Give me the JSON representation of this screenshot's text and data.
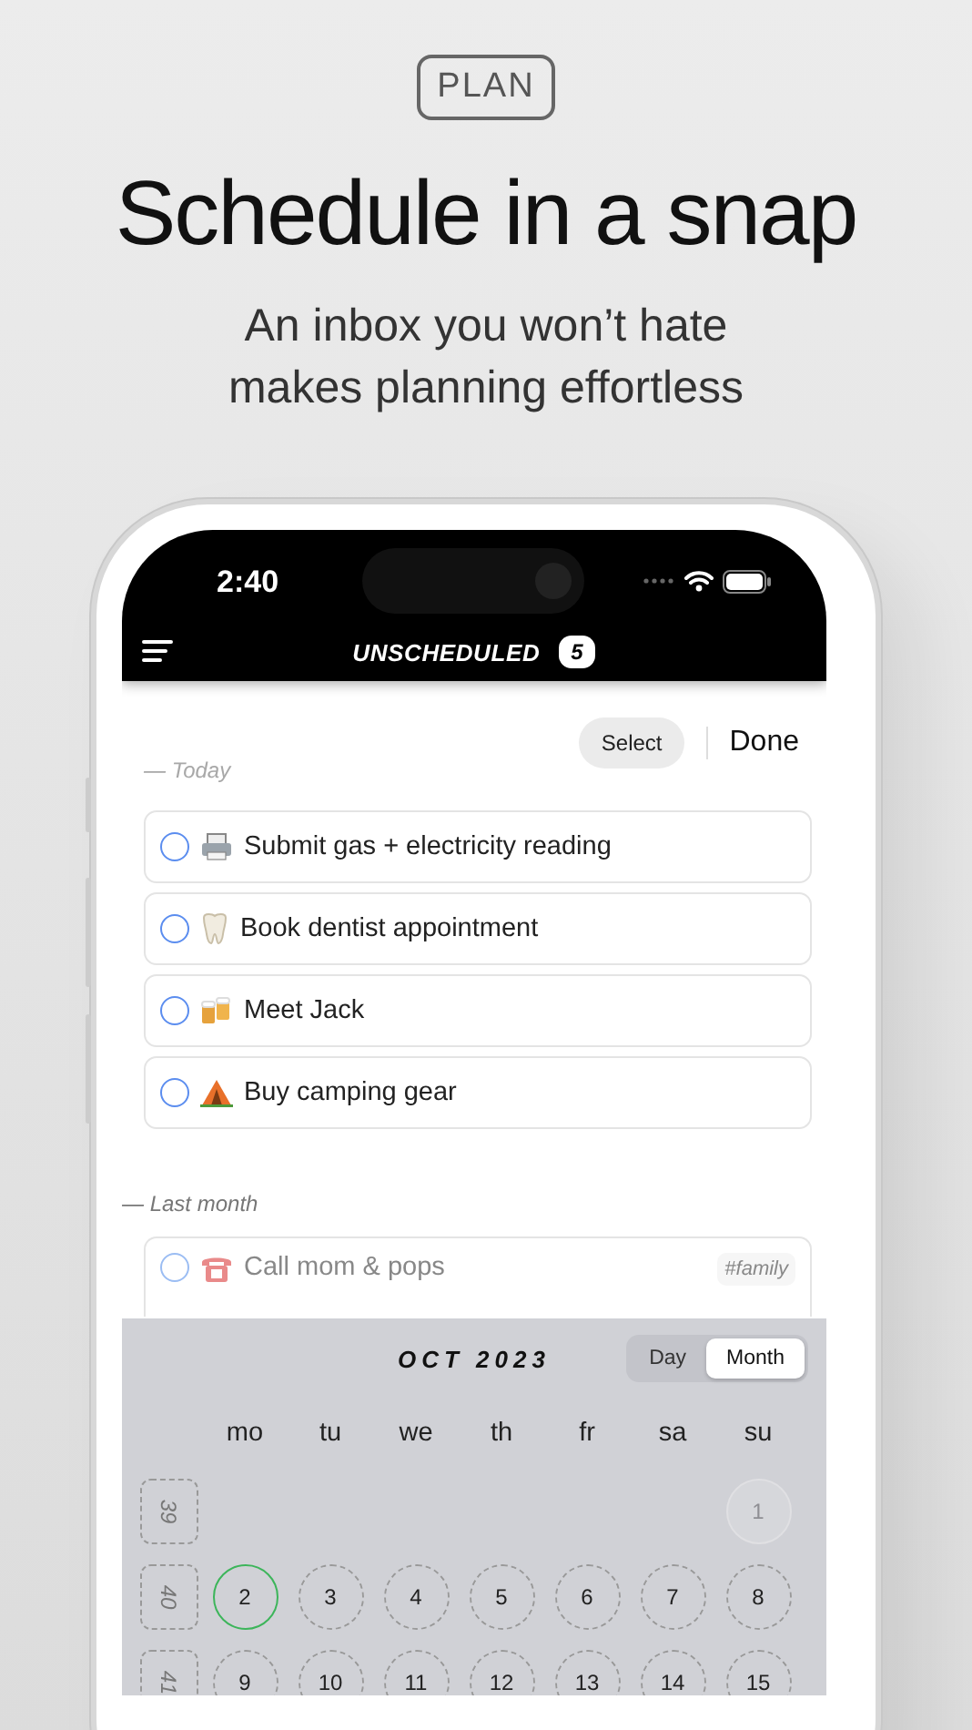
{
  "badge": "PLAN",
  "headline": "Schedule in a snap",
  "subtitle": "An inbox you won’t hate\nmakes planning effortless",
  "status_bar": {
    "time": "2:40"
  },
  "nav": {
    "title": "UNSCHEDULED",
    "count": "5"
  },
  "toolbar": {
    "select": "Select",
    "done": "Done"
  },
  "sections": [
    {
      "label": "— Today",
      "faded": true,
      "items": [
        {
          "text": "Submit gas + electricity reading",
          "checked": false,
          "faded": false
        },
        {
          "text": "Book dentist appointment",
          "checked": false,
          "faded": false
        },
        {
          "text": "Meet Jack",
          "checked": false,
          "faded": false
        },
        {
          "text": "Buy camping gear",
          "checked": false,
          "faded": false
        }
      ]
    },
    {
      "label": "— Last month",
      "faded": false,
      "items": [
        {
          "text": "Call mom & pops",
          "tag": "#family",
          "checked": false,
          "faded": true
        }
      ]
    }
  ],
  "calendar": {
    "title": "OCT 2023",
    "modes": [
      {
        "label": "Day",
        "selected": false
      },
      {
        "label": "Month",
        "selected": true
      }
    ],
    "weekdays": [
      "mo",
      "tu",
      "we",
      "th",
      "fr",
      "sa",
      "su"
    ],
    "weeks": [
      {
        "number": "39",
        "days": [
          {
            "label": "1",
            "muted": true,
            "today": false
          }
        ]
      },
      {
        "number": "40",
        "days": [
          {
            "label": "2",
            "muted": false,
            "today": true
          },
          {
            "label": "3",
            "muted": false,
            "today": false
          },
          {
            "label": "4",
            "muted": false,
            "today": false
          },
          {
            "label": "5",
            "muted": false,
            "today": false
          },
          {
            "label": "6",
            "muted": false,
            "today": false
          },
          {
            "label": "7",
            "muted": false,
            "today": false
          },
          {
            "label": "8",
            "muted": false,
            "today": false
          }
        ]
      },
      {
        "number": "41",
        "days": [
          {
            "label": "9",
            "muted": false,
            "today": false
          },
          {
            "label": "10",
            "muted": false,
            "today": false
          },
          {
            "label": "11",
            "muted": false,
            "today": false
          },
          {
            "label": "12",
            "muted": false,
            "today": false
          },
          {
            "label": "13",
            "muted": false,
            "today": false
          },
          {
            "label": "14",
            "muted": false,
            "today": false
          },
          {
            "label": "15",
            "muted": false,
            "today": false
          }
        ]
      }
    ]
  }
}
